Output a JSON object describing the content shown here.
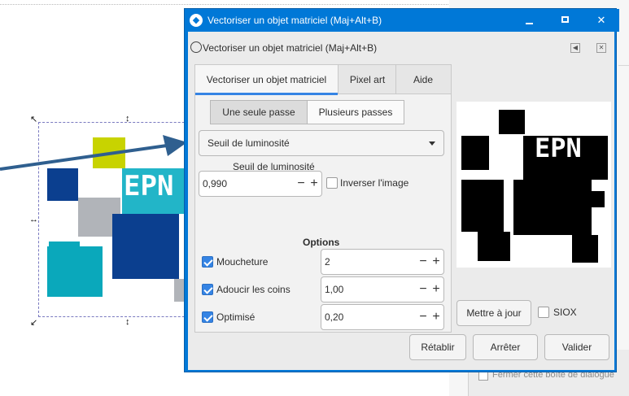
{
  "background": {
    "checkbox_label": "Fermer cette boîte de dialogue"
  },
  "image": {
    "logo_text": "EPN",
    "colors": {
      "teal": "#22b5c8",
      "navy": "#0b3f8f",
      "lime": "#c8d300",
      "grey": "#b1b4b9",
      "darkteal": "#0aa8bb"
    }
  },
  "window": {
    "title": "Vectoriser un objet matriciel (Maj+Alt+B)",
    "dock_title": "Vectoriser un objet matriciel (Maj+Alt+B)",
    "accent": "#0078d7"
  },
  "tabs": [
    {
      "label": "Vectoriser un objet matriciel"
    },
    {
      "label": "Pixel art"
    },
    {
      "label": "Aide"
    }
  ],
  "mode": {
    "single": "Une seule passe",
    "multi": "Plusieurs passes"
  },
  "method": {
    "selected": "Seuil de luminosité"
  },
  "threshold": {
    "label": "Seuil de luminosité",
    "value": "0,990",
    "invert_label": "Inverser l'image"
  },
  "options": {
    "title": "Options",
    "items": [
      {
        "label": "Moucheture",
        "value": "2",
        "checked": true
      },
      {
        "label": "Adoucir les coins",
        "value": "1,00",
        "checked": true
      },
      {
        "label": "Optimisé",
        "value": "0,20",
        "checked": true
      }
    ]
  },
  "preview": {
    "text": "EPN",
    "update_label": "Mettre à jour",
    "siox_label": "SIOX"
  },
  "footer": {
    "reset": "Rétablir",
    "stop": "Arrêter",
    "ok": "Valider"
  },
  "icons": {
    "minimize": "minimize-icon",
    "maximize": "maximize-icon",
    "close": "close-icon",
    "plus": "+",
    "minus": "−"
  }
}
